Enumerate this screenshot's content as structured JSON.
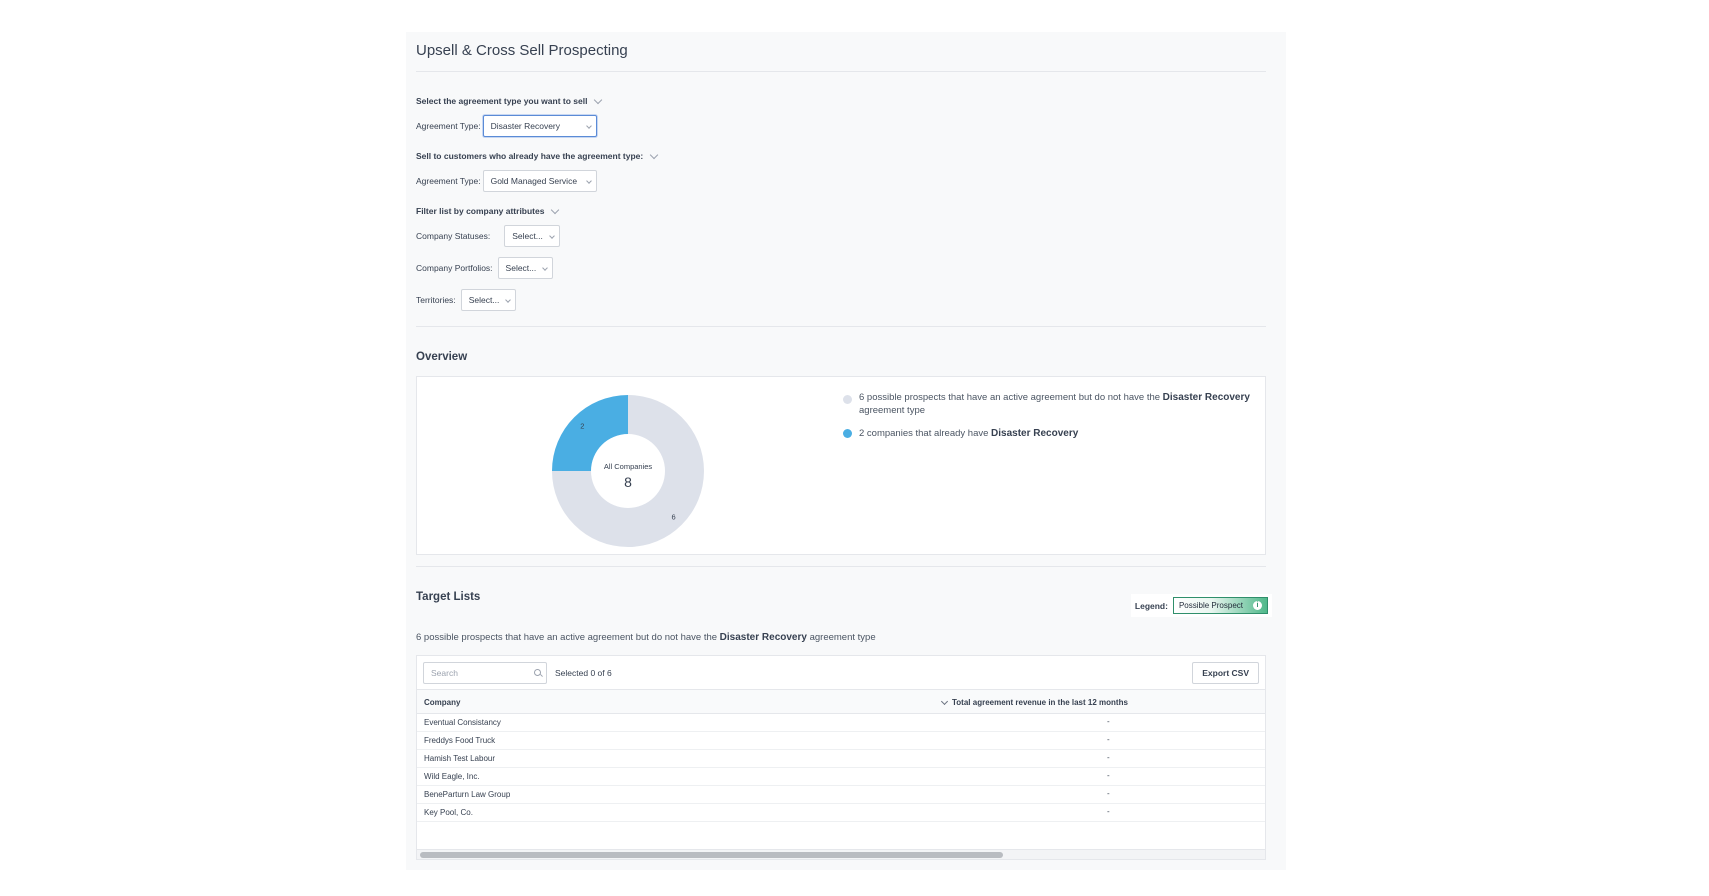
{
  "page": {
    "title": "Upsell & Cross Sell Prospecting"
  },
  "sell_section": {
    "label": "Select the agreement type you want to sell",
    "field_label": "Agreement Type:",
    "value": "Disaster Recovery"
  },
  "existing_section": {
    "label": "Sell to customers who already have the agreement type:",
    "field_label": "Agreement Type:",
    "value": "Gold Managed Service"
  },
  "filter_section": {
    "label": "Filter list by company attributes",
    "statuses_label": "Company Statuses:",
    "statuses_value": "Select...",
    "portfolios_label": "Company Portfolios:",
    "portfolios_value": "Select...",
    "territories_label": "Territories:",
    "territories_value": "Select..."
  },
  "overview": {
    "heading": "Overview",
    "center_label": "All Companies",
    "center_value": "8",
    "legend": [
      {
        "text_before": "6 possible prospects that have an active agreement but do not have the ",
        "bold": "Disaster Recovery",
        "text_after": " agreement type",
        "color": "#dde1ea"
      },
      {
        "text_before": "2 companies that already have ",
        "bold": "Disaster Recovery",
        "text_after": "",
        "color": "#4aaee3"
      }
    ]
  },
  "chart_data": {
    "type": "pie",
    "categories": [
      "Possible prospects",
      "Already have Disaster Recovery"
    ],
    "values": [
      6,
      2
    ],
    "colors": [
      "#dde1ea",
      "#4aaee3"
    ],
    "donut": true,
    "title": "",
    "center_label": "All Companies",
    "center_value": 8
  },
  "target_lists": {
    "heading": "Target Lists",
    "legend_label": "Legend:",
    "legend_badge": "Possible Prospect",
    "legend_badge_color": "#4fb88a",
    "subtext_before": "6 possible prospects that have an active agreement but do not have the ",
    "subtext_bold": "Disaster Recovery",
    "subtext_after": " agreement type",
    "search_placeholder": "Search",
    "selected_text": "Selected 0 of 6",
    "export_label": "Export CSV",
    "columns": [
      "Company",
      "Total agreement revenue in the last 12 months"
    ],
    "rows": [
      {
        "company": "Eventual Consistancy",
        "revenue": "-"
      },
      {
        "company": "Freddys Food Truck",
        "revenue": "-"
      },
      {
        "company": "Hamish Test Labour",
        "revenue": "-"
      },
      {
        "company": "Wild Eagle, Inc.",
        "revenue": "-"
      },
      {
        "company": "BeneParturn Law Group",
        "revenue": "-"
      },
      {
        "company": "Key Pool, Co.",
        "revenue": "-"
      }
    ]
  }
}
